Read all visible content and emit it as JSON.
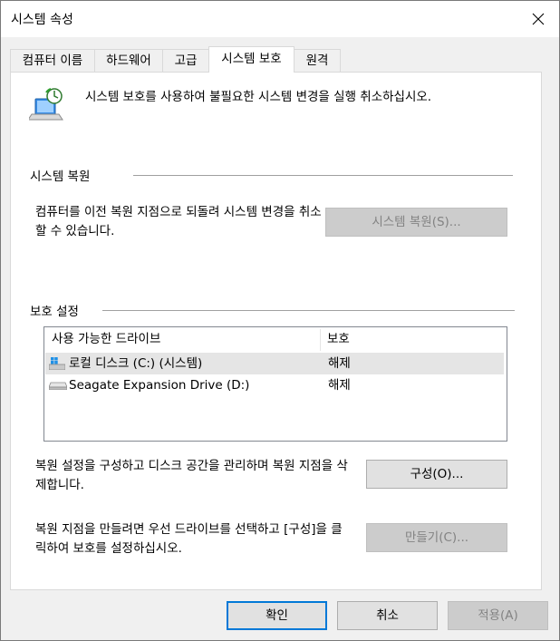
{
  "window": {
    "title": "시스템 속성"
  },
  "tabs": [
    {
      "label": "컴퓨터 이름"
    },
    {
      "label": "하드웨어"
    },
    {
      "label": "고급"
    },
    {
      "label": "시스템 보호"
    },
    {
      "label": "원격"
    }
  ],
  "intro": {
    "text": "시스템 보호를 사용하여 불필요한 시스템 변경을 실행 취소하십시오."
  },
  "restore": {
    "heading": "시스템 복원",
    "description": "컴퓨터를 이전 복원 지점으로 되돌려 시스템 변경을 취소할 수 있습니다.",
    "button_label": "시스템 복원(S)..."
  },
  "protection": {
    "heading": "보호 설정",
    "columns": [
      "사용 가능한 드라이브",
      "보호"
    ],
    "drives": [
      {
        "name": "로컬 디스크 (C:) (시스템)",
        "protection": "해제",
        "icon": "windows-drive-icon"
      },
      {
        "name": "Seagate Expansion Drive (D:)",
        "protection": "해제",
        "icon": "hard-drive-icon"
      }
    ],
    "configure_text": "복원 설정을 구성하고 디스크 공간을 관리하며 복원 지점을 삭제합니다.",
    "configure_button": "구성(O)...",
    "create_text": "복원 지점을 만들려면 우선 드라이브를 선택하고 [구성]을 클릭하여 보호를 설정하십시오.",
    "create_button": "만들기(C)..."
  },
  "footer": {
    "ok": "확인",
    "cancel": "취소",
    "apply": "적용(A)"
  },
  "colors": {
    "accent": "#0078d7",
    "selected_row": "#e5e5e5",
    "disabled_text": "#838383"
  }
}
